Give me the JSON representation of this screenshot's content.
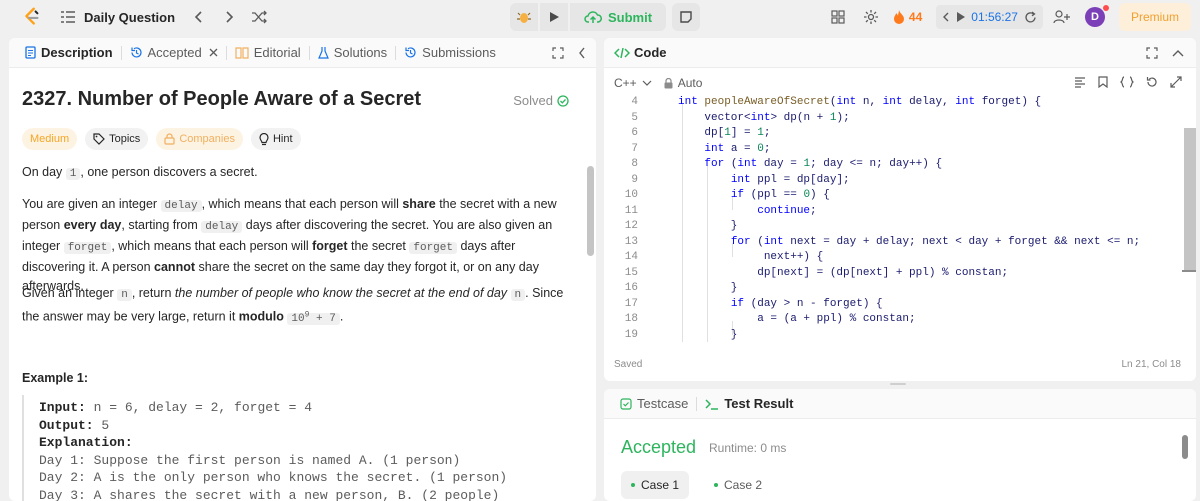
{
  "topbar": {
    "title": "Daily Question",
    "submit_label": "Submit",
    "streak": "44",
    "timer": "01:56:27",
    "avatar_initial": "D",
    "premium_label": "Premium"
  },
  "description": {
    "tabs": [
      {
        "label": "Description"
      },
      {
        "label": "Accepted"
      },
      {
        "label": "Editorial"
      },
      {
        "label": "Solutions"
      },
      {
        "label": "Submissions"
      }
    ],
    "title": "2327. Number of People Aware of a Secret",
    "solved_label": "Solved",
    "badges": {
      "difficulty": "Medium",
      "topics": "Topics",
      "companies": "Companies",
      "hint": "Hint"
    },
    "p1": {
      "a": "On day ",
      "c1": "1",
      "b": ", one person discovers a secret."
    },
    "p2": {
      "a": "You are given an integer ",
      "c1": "delay",
      "b": ", which means that each person will ",
      "bold1": "share",
      "c": " the secret with a new person ",
      "bold2": "every day",
      "d": ", starting from ",
      "c2": "delay",
      "e": " days after discovering the secret. You are also given an integer ",
      "c3": "forget",
      "f": ", which means that each person will ",
      "bold3": "forget",
      "g": " the secret ",
      "c4": "forget",
      "h": " days after discovering it. A person ",
      "bold4": "cannot",
      "i": " share the secret on the same day they forgot it, or on any day afterwards."
    },
    "p3": {
      "a": "Given an integer ",
      "c1": "n",
      "b": ", return ",
      "ital": "the number of people who know the secret at the end of day ",
      "c2": "n",
      "c": ". Since the answer may be very large, return it ",
      "bold": "modulo",
      "mod_base": "10",
      "mod_exp": "9",
      "mod_rest": " + 7",
      "d": "."
    },
    "example_title": "Example 1:",
    "example": {
      "input_label": "Input:",
      "input_value": " n = 6, delay = 2, forget = 4",
      "output_label": "Output:",
      "output_value": " 5",
      "explanation_label": "Explanation:",
      "lines": [
        "Day 1: Suppose the first person is named A. (1 person)",
        "Day 2: A is the only person who knows the secret. (1 person)",
        "Day 3: A shares the secret with a new person, B. (2 people)"
      ]
    }
  },
  "editor": {
    "title": "Code",
    "language": "C++",
    "mode": "Auto",
    "status_left": "Saved",
    "status_right": "Ln 21, Col 18",
    "line_numbers": [
      "4",
      "5",
      "6",
      "7",
      "8",
      "9",
      "10",
      "11",
      "12",
      "13",
      "14",
      "15",
      "16",
      "17",
      "18",
      "19"
    ]
  },
  "test": {
    "tab_testcase": "Testcase",
    "tab_result": "Test Result",
    "result": "Accepted",
    "runtime": "Runtime: 0 ms",
    "cases": [
      "Case 1",
      "Case 2"
    ]
  }
}
